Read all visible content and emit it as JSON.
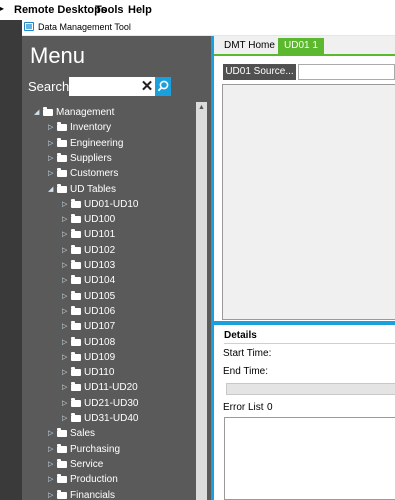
{
  "menubar": {
    "items": [
      "Remote Desktops",
      "Tools",
      "Help"
    ]
  },
  "window": {
    "title": "Data Management Tool"
  },
  "sidebar": {
    "title": "Menu",
    "search_label": "Search",
    "search_value": "",
    "clear_glyph": "✕",
    "tree": [
      {
        "label": "Management",
        "level": 0,
        "expanded": true
      },
      {
        "label": "Inventory",
        "level": 1,
        "expanded": false
      },
      {
        "label": "Engineering",
        "level": 1,
        "expanded": false
      },
      {
        "label": "Suppliers",
        "level": 1,
        "expanded": false
      },
      {
        "label": "Customers",
        "level": 1,
        "expanded": false
      },
      {
        "label": "UD Tables",
        "level": 1,
        "expanded": true
      },
      {
        "label": "UD01-UD10",
        "level": 2,
        "expanded": false
      },
      {
        "label": "UD100",
        "level": 2,
        "expanded": false
      },
      {
        "label": "UD101",
        "level": 2,
        "expanded": false
      },
      {
        "label": "UD102",
        "level": 2,
        "expanded": false
      },
      {
        "label": "UD103",
        "level": 2,
        "expanded": false
      },
      {
        "label": "UD104",
        "level": 2,
        "expanded": false
      },
      {
        "label": "UD105",
        "level": 2,
        "expanded": false
      },
      {
        "label": "UD106",
        "level": 2,
        "expanded": false
      },
      {
        "label": "UD107",
        "level": 2,
        "expanded": false
      },
      {
        "label": "UD108",
        "level": 2,
        "expanded": false
      },
      {
        "label": "UD109",
        "level": 2,
        "expanded": false
      },
      {
        "label": "UD110",
        "level": 2,
        "expanded": false
      },
      {
        "label": "UD11-UD20",
        "level": 2,
        "expanded": false
      },
      {
        "label": "UD21-UD30",
        "level": 2,
        "expanded": false
      },
      {
        "label": "UD31-UD40",
        "level": 2,
        "expanded": false
      },
      {
        "label": "Sales",
        "level": 1,
        "expanded": false
      },
      {
        "label": "Purchasing",
        "level": 1,
        "expanded": false
      },
      {
        "label": "Service",
        "level": 1,
        "expanded": false
      },
      {
        "label": "Production",
        "level": 1,
        "expanded": false
      },
      {
        "label": "Financials",
        "level": 1,
        "expanded": false
      }
    ]
  },
  "tabs": [
    {
      "label": "DMT Home",
      "active": false
    },
    {
      "label": "UD01 1",
      "active": true
    }
  ],
  "main": {
    "source_button": "UD01 Source...",
    "source_value": ""
  },
  "details": {
    "heading": "Details",
    "start_label": "Start Time:",
    "end_label": "End Time:",
    "progress": 0,
    "error_list_label": "Error List",
    "error_count": "0"
  },
  "colors": {
    "accent_blue": "#1aa0dc",
    "tab_green": "#5cb82e",
    "sidebar_bg": "#5a5a5a"
  }
}
